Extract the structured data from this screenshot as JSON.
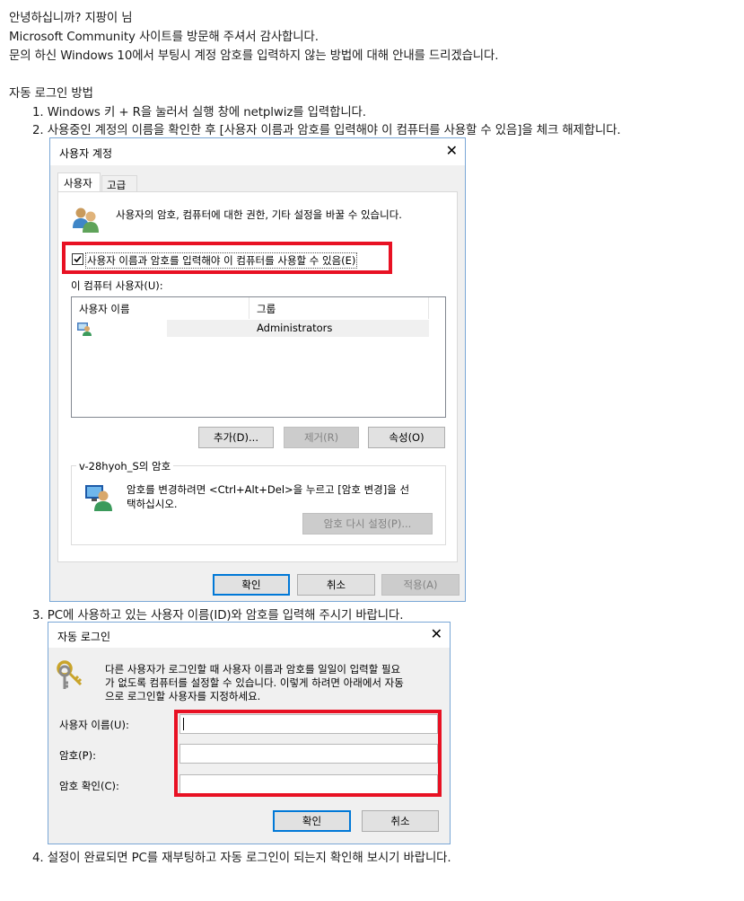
{
  "intro": {
    "greeting": "안녕하십니까? 지팡이 님",
    "thanks": "Microsoft Community 사이트를 방문해 주셔서 감사합니다.",
    "question": "문의 하신 Windows 10에서 부팅시 계정 암호를 입력하지 않는 방법에 대해 안내를 드리겠습니다."
  },
  "section_title": "자동 로그인 방법",
  "steps": [
    "1. Windows 키 + R을 눌러서 실행 창에 netplwiz를 입력합니다.",
    "2. 사용중인 계정의 이름을 확인한 후 [사용자 이름과 암호를 입력해야 이 컴퓨터를 사용할 수 있음]을 체크 해제합니다.",
    "3. PC에 사용하고 있는 사용자 이름(ID)와 암호를 입력해 주시기 바랍니다.",
    "4. 설정이 완료되면 PC를 재부팅하고 자동 로그인이 되는지 확인해 보시기 바랍니다."
  ],
  "dialog1": {
    "title": "사용자 계정",
    "tabs": [
      "사용자",
      "고급"
    ],
    "description": "사용자의 암호, 컴퓨터에 대한 권한, 기타 설정을 바꿀 수 있습니다.",
    "checkbox_label": "사용자 이름과 암호를 입력해야 이 컴퓨터를 사용할 수 있음(E)",
    "checkbox_checked": true,
    "users_label": "이 컴퓨터 사용자(U):",
    "columns": [
      "사용자 이름",
      "그룹"
    ],
    "rows": [
      {
        "name": "",
        "group": "Administrators"
      }
    ],
    "buttons": {
      "add": "추가(D)...",
      "remove": "제거(R)",
      "properties": "속성(O)"
    },
    "password_group": "v-28hyoh_S의 암호",
    "password_text_1": "암호를 변경하려면 <Ctrl+Alt+Del>을 누르고 [암호 변경]을 선",
    "password_text_2": "택하십시오.",
    "reset_button": "암호 다시 설정(P)...",
    "ok": "확인",
    "cancel": "취소",
    "apply": "적용(A)"
  },
  "dialog2": {
    "title": "자동 로그인",
    "description_1": "다른 사용자가 로그인할 때 사용자 이름과 암호를 일일이 입력할 필요",
    "description_2": "가 없도록 컴퓨터를 설정할 수 있습니다. 이렇게 하려면 아래에서 자동",
    "description_3": "으로 로그인할 사용자를 지정하세요.",
    "username_label": "사용자 이름(U):",
    "password_label": "암호(P):",
    "confirm_label": "암호 확인(C):",
    "username_value": "",
    "password_value": "",
    "confirm_value": "",
    "ok": "확인",
    "cancel": "취소"
  },
  "colors": {
    "highlight": "#e81123",
    "accent": "#0078d7"
  }
}
